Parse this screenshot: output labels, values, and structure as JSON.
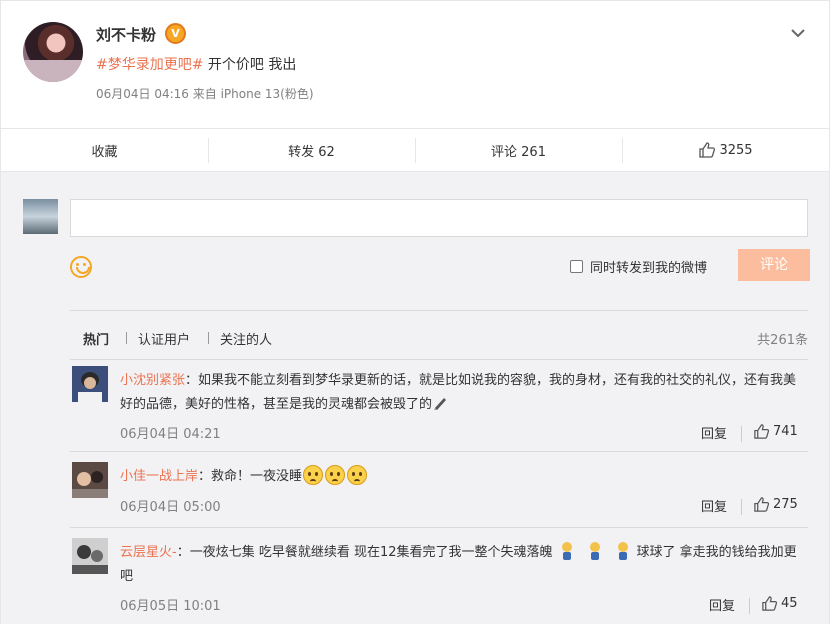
{
  "post": {
    "author": "刘不卡粉",
    "verified_badge": "V",
    "hashtag": "#梦华录加更吧#",
    "text": " 开个价吧 我出",
    "meta": "06月04日 04:16  来自 iPhone 13(粉色)"
  },
  "actions": {
    "favorite": "收藏",
    "repost": "转发 62",
    "comment": "评论 261",
    "like": "3255"
  },
  "compose": {
    "input_value": "",
    "input_placeholder": "",
    "forward_label": "同时转发到我的微博",
    "forward_checked": false,
    "submit": "评论"
  },
  "filters": {
    "hot": "热门",
    "verified": "认证用户",
    "following": "关注的人",
    "total": "共261条"
  },
  "comments": [
    {
      "user": "小沈别紧张",
      "text": "：如果我不能立刻看到梦华录更新的话，就是比如说我的容貌，我的身材，还有我的社交的礼仪，还有我美好的品德，美好的性格，甚至是我的灵魂都会被毁了的",
      "time": "06月04日 04:21",
      "reply": "回复",
      "likes": "741"
    },
    {
      "user": "小佳一战上岸",
      "text": "：救命！一夜没睡",
      "time": "06月04日 05:00",
      "reply": "回复",
      "likes": "275"
    },
    {
      "user": "云层星火-",
      "text_a": "：一夜炫七集 吃早餐就继续看 现在12集看完了我一整个失魂落魄",
      "text_b": "球球了 拿走我的钱给我加更吧",
      "time": "06月05日 10:01",
      "reply": "回复",
      "likes": "45"
    }
  ],
  "colors": {
    "link_orange": "#eb7350",
    "muted_text": "#808080",
    "submit_disabled": "#fbbd9e",
    "comment_bg": "#f2f2f5"
  }
}
